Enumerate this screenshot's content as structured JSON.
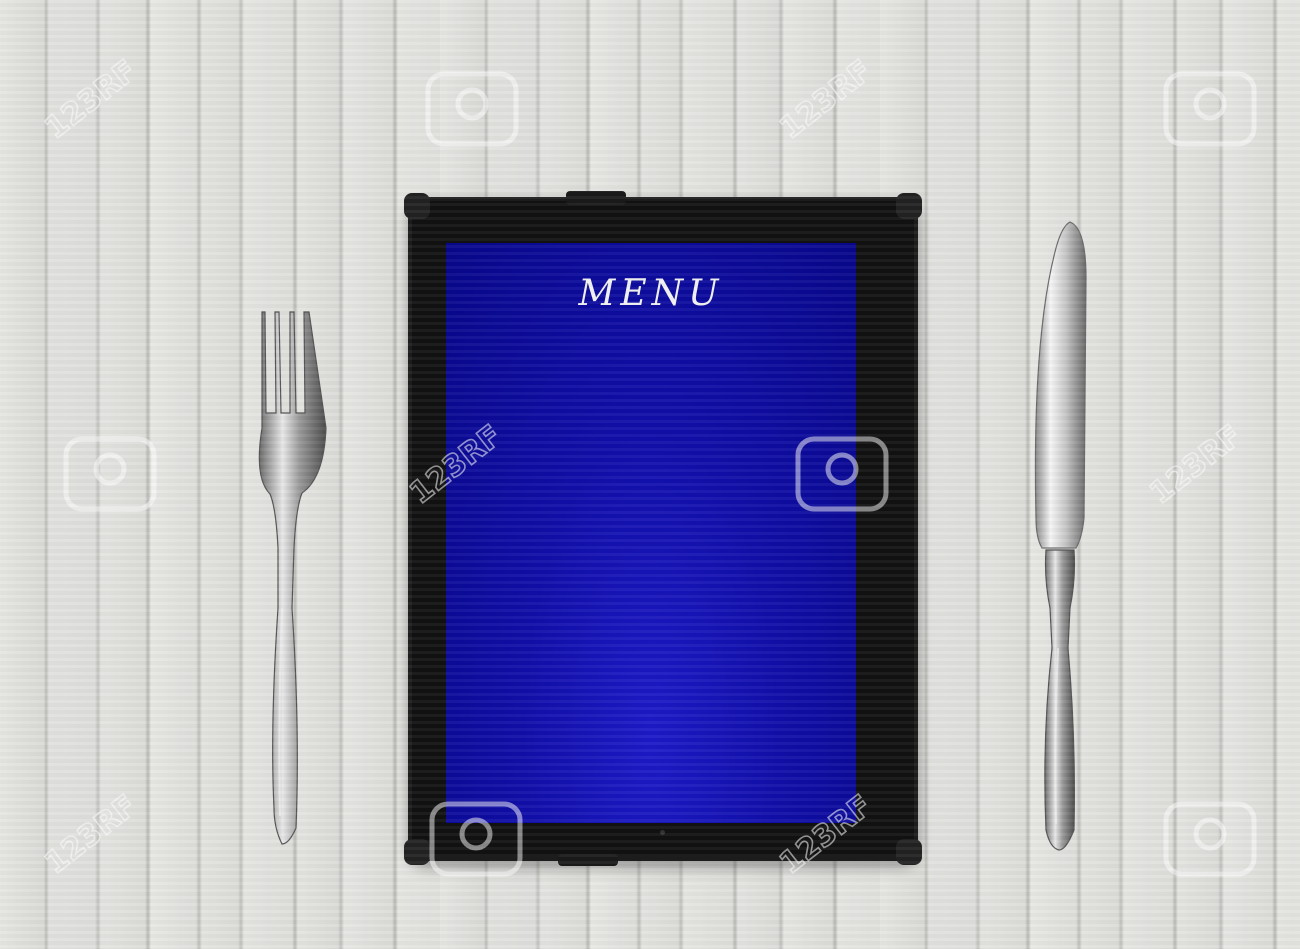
{
  "screen": {
    "title": "MENU",
    "background_color": "#0d0ca4"
  },
  "watermark": {
    "text": "123RF",
    "icon": "camera-watermark-icon"
  },
  "icons": {
    "fork": "fork-icon",
    "knife": "knife-icon"
  }
}
